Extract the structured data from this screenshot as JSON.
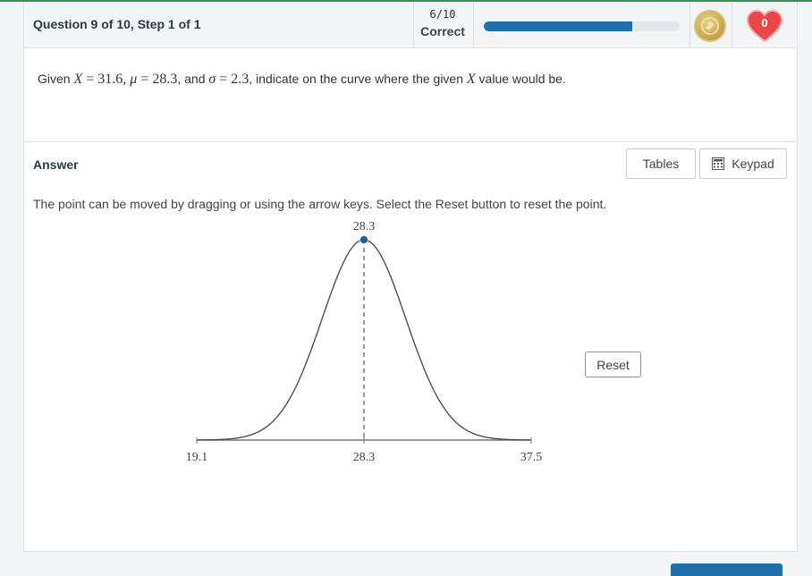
{
  "header": {
    "question_label": "Question 9 of 10, Step 1 of 1",
    "score_fraction": "6/10",
    "score_status": "Correct",
    "progress_fraction": 0.76,
    "coin_icon": "coin-icon",
    "hearts_count": "0",
    "colors": {
      "progress": "#1f6fa8",
      "heart": "#e8484a",
      "accent": "#3e8b57"
    }
  },
  "question": {
    "prefix": "Given ",
    "x_var": "X",
    "eq1": " = 31.6, ",
    "mu": "μ",
    "eq2": " = 28.3",
    "and": ", and ",
    "sigma": "σ",
    "eq3": " = 2.3",
    "middle": ", indicate on the curve where the given ",
    "x_var2": "X",
    "suffix": " value would be."
  },
  "answer": {
    "label": "Answer",
    "tables_button": "Tables",
    "keypad_button": "Keypad",
    "instruction": "The point can be moved by dragging or using the arrow keys. Select the Reset button to reset the point.",
    "reset_button": "Reset"
  },
  "chart_data": {
    "type": "line",
    "description_kind": "normal-curve",
    "mean": 28.3,
    "sd": 2.3,
    "xlim": [
      19.1,
      37.5
    ],
    "x_ticks": [
      "19.1",
      "28.3",
      "37.5"
    ],
    "point_x": 28.3,
    "point_label": "28.3"
  }
}
